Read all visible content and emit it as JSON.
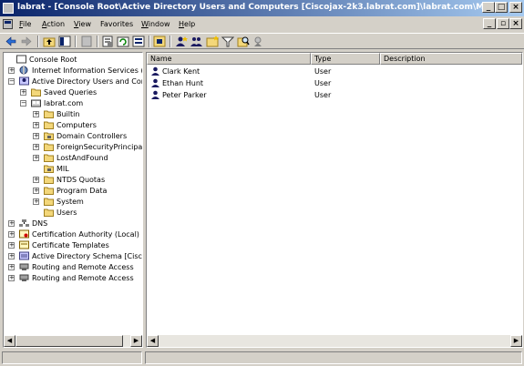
{
  "window": {
    "title": "labrat - [Console Root\\Active Directory Users and Computers [Ciscojax-2k3.labrat.com]\\labrat.com\\MIL]",
    "minimize": "_",
    "maximize": "□",
    "close": "×"
  },
  "menu": {
    "items": [
      {
        "label": "File",
        "accel": "F",
        "rest": "ile"
      },
      {
        "label": "Action",
        "accel": "A",
        "rest": "ction"
      },
      {
        "label": "View",
        "accel": "V",
        "rest": "iew"
      },
      {
        "label": "Favorites",
        "accel": "",
        "rest": "Favorites"
      },
      {
        "label": "Window",
        "accel": "W",
        "rest": "indow"
      },
      {
        "label": "Help",
        "accel": "H",
        "rest": "elp"
      }
    ],
    "mdi_minimize": "_",
    "mdi_restore": "▫",
    "mdi_close": "×"
  },
  "tree": {
    "items": [
      {
        "label": "Console Root",
        "icon": "console-root-icon",
        "expander": ""
      },
      {
        "label": "Internet Information Services (II",
        "icon": "iis-icon",
        "expander": "+"
      },
      {
        "label": "Active Directory Users and Comp",
        "icon": "ad-icon",
        "expander": "−"
      },
      {
        "label": "Saved Queries",
        "icon": "folder-icon",
        "expander": "+"
      },
      {
        "label": "labrat.com",
        "icon": "domain-icon",
        "expander": "−"
      },
      {
        "label": "Builtin",
        "icon": "folder-icon",
        "expander": "+"
      },
      {
        "label": "Computers",
        "icon": "folder-icon",
        "expander": "+"
      },
      {
        "label": "Domain Controllers",
        "icon": "ou-icon",
        "expander": "+"
      },
      {
        "label": "ForeignSecurityPrincipals",
        "icon": "folder-icon",
        "expander": "+"
      },
      {
        "label": "LostAndFound",
        "icon": "folder-icon",
        "expander": "+"
      },
      {
        "label": "MIL",
        "icon": "ou-icon",
        "expander": ""
      },
      {
        "label": "NTDS Quotas",
        "icon": "folder-icon",
        "expander": "+"
      },
      {
        "label": "Program Data",
        "icon": "folder-icon",
        "expander": "+"
      },
      {
        "label": "System",
        "icon": "folder-icon",
        "expander": "+"
      },
      {
        "label": "Users",
        "icon": "folder-icon",
        "expander": ""
      },
      {
        "label": "DNS",
        "icon": "dns-icon",
        "expander": "+"
      },
      {
        "label": "Certification Authority (Local)",
        "icon": "ca-icon",
        "expander": "+"
      },
      {
        "label": "Certificate Templates",
        "icon": "cert-templates-icon",
        "expander": "+"
      },
      {
        "label": "Active Directory Schema [Ciscoja",
        "icon": "schema-icon",
        "expander": "+"
      },
      {
        "label": "Routing and Remote Access",
        "icon": "rras-icon",
        "expander": "+"
      },
      {
        "label": "Routing and Remote Access",
        "icon": "rras-icon",
        "expander": "+"
      }
    ]
  },
  "list": {
    "columns": [
      "Name",
      "Type",
      "Description"
    ],
    "rows": [
      {
        "name": "Clark Kent",
        "type": "User",
        "description": ""
      },
      {
        "name": "Ethan Hunt",
        "type": "User",
        "description": ""
      },
      {
        "name": "Peter Parker",
        "type": "User",
        "description": ""
      }
    ]
  },
  "colors": {
    "title_start": "#0a246a",
    "title_end": "#a6caf0",
    "selection": "#d4d0c8",
    "chrome": "#d4d0c8"
  }
}
